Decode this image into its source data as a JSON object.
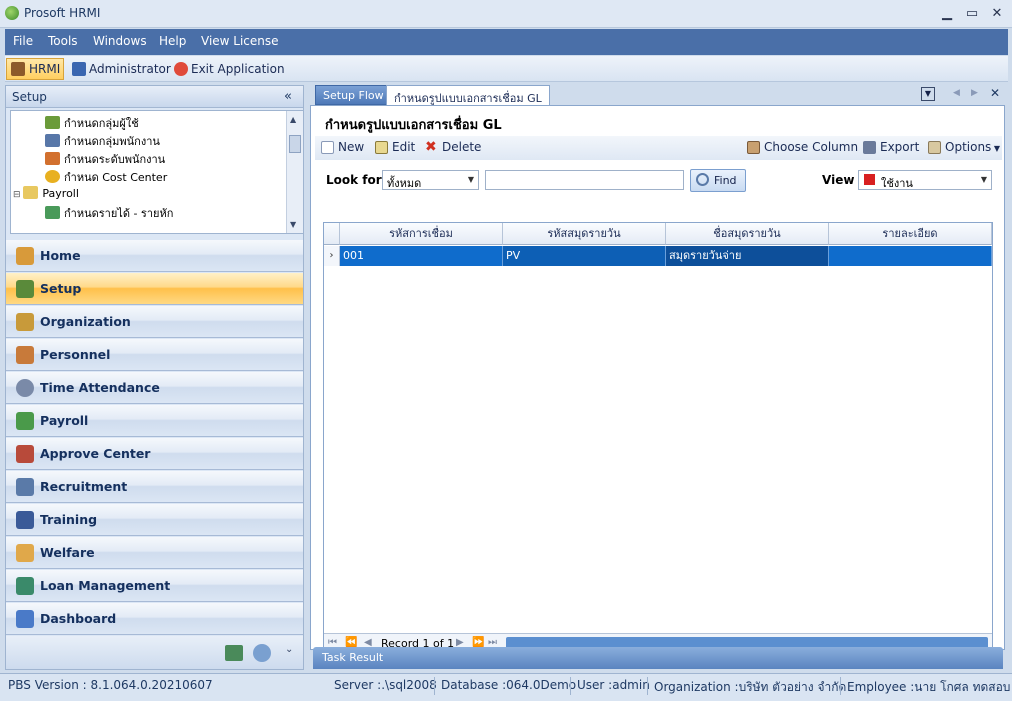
{
  "window": {
    "title": "Prosoft HRMI"
  },
  "menu": [
    "File",
    "Tools",
    "Windows",
    "Help",
    "View License"
  ],
  "toolbar": {
    "hrmi": "HRMI",
    "admin": "Administrator",
    "exit": "Exit Application"
  },
  "left": {
    "header": "Setup",
    "collapse_glyph": "«",
    "tree": [
      "กำหนดกลุ่มผู้ใช้",
      "กำหนดกลุ่มพนักงาน",
      "กำหนดระดับพนักงาน",
      "กำหนด Cost Center",
      "Payroll",
      "กำหนดรายได้ - รายหัก"
    ],
    "nav": [
      "Home",
      "Setup",
      "Organization",
      "Personnel",
      "Time Attendance",
      "Payroll",
      "Approve Center",
      "Recruitment",
      "Training",
      "Welfare",
      "Loan Management",
      "Dashboard"
    ]
  },
  "tabs": [
    "Setup Flow",
    "กำหนดรูปแบบเอกสารเชื่อม GL"
  ],
  "form": {
    "title": "กำหนดรูปแบบเอกสารเชื่อม GL",
    "actions": {
      "new": "New",
      "edit": "Edit",
      "delete": "Delete",
      "choose_column": "Choose Column",
      "export": "Export",
      "options": "Options"
    },
    "look_for_label": "Look for",
    "look_for_value": "ทั้งหมด",
    "search_value": "",
    "find": "Find",
    "view_label": "View",
    "view_value": "ใช้งาน"
  },
  "grid": {
    "columns": [
      "รหัสการเชื่อม",
      "รหัสสมุดรายวัน",
      "ชื่อสมุดรายวัน",
      "รายละเอียด"
    ],
    "rows": [
      [
        "001",
        "PV",
        "สมุดรายวันจ่าย",
        ""
      ]
    ],
    "record_text": "Record 1 of 1"
  },
  "task_result": "Task Result",
  "status": {
    "version": "PBS Version : 8.1.064.0.20210607",
    "server": "Server :.\\sql2008",
    "database": "Database :064.0Demo",
    "user": "User :admin",
    "organization": "Organization :บริษัท ตัวอย่าง จำกัด",
    "employee": "Employee :นาย โกศล ทดสอบ"
  },
  "colors": {
    "accent": "#4a6fa8",
    "selection": "#0f6ccc",
    "active_nav": "#ffc04a"
  }
}
